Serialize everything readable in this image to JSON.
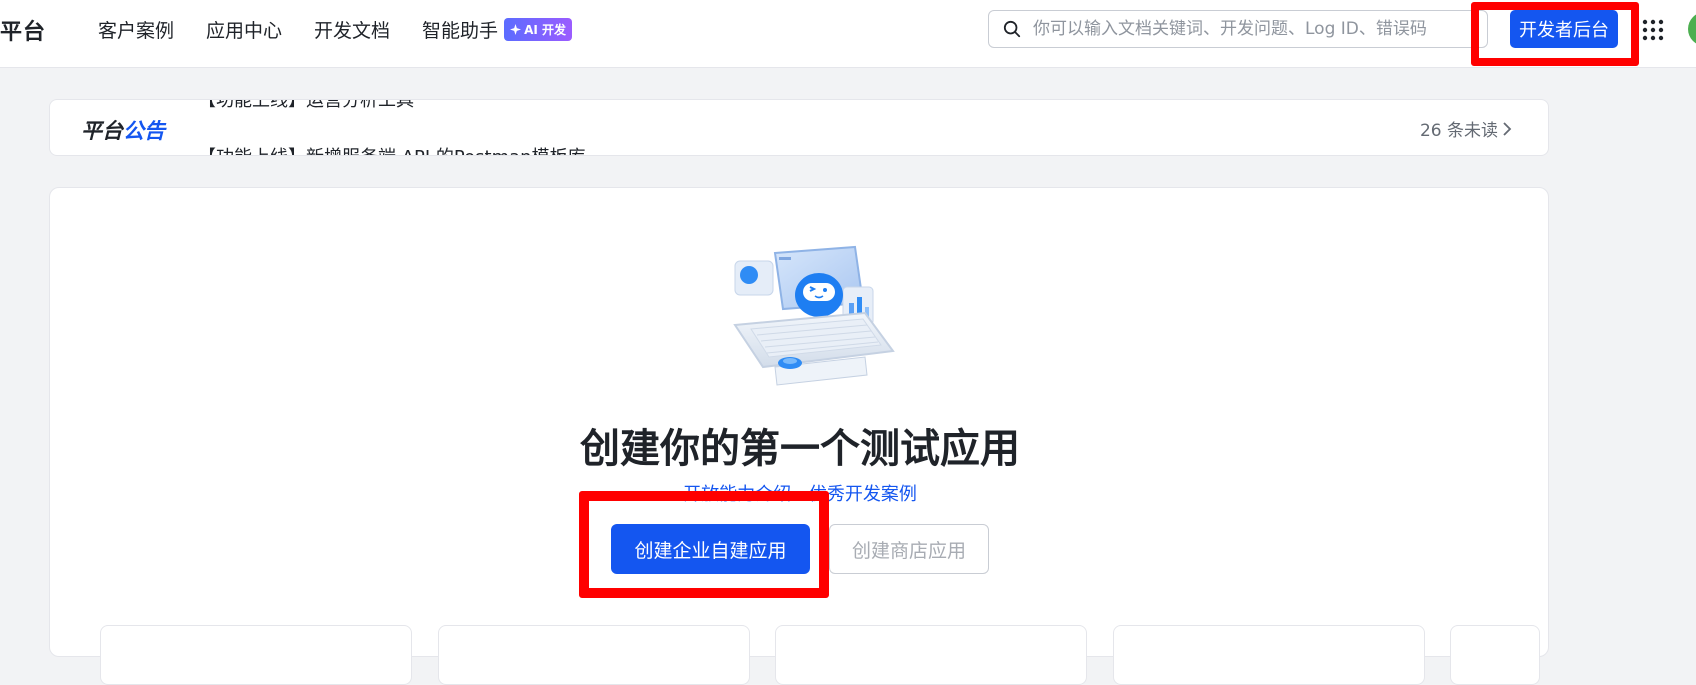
{
  "header": {
    "brand": "平台",
    "nav": [
      {
        "label": "客户案例"
      },
      {
        "label": "应用中心"
      },
      {
        "label": "开发文档"
      },
      {
        "label": "智能助手"
      }
    ],
    "ai_badge": "AI 开发",
    "search_placeholder": "你可以输入文档关键词、开发问题、Log ID、错误码",
    "dev_console_button": "开发者后台"
  },
  "announcement": {
    "title_part1": "平台",
    "title_part2": "公告",
    "items": [
      "【功能上线】运营分析工具",
      "【功能上线】新增服务端 API 的Postman模板库"
    ],
    "unread": "26 条未读"
  },
  "main": {
    "headline": "创建你的第一个测试应用",
    "link1": "开放能力介绍",
    "link2": "优秀开发案例",
    "create_custom_app": "创建企业自建应用",
    "create_store_app": "创建商店应用"
  },
  "colors": {
    "primary": "#1456f0",
    "highlight": "#ff0000",
    "background": "#f2f3f5"
  },
  "icons": {
    "search": "search-icon",
    "apps": "apps-grid-icon",
    "chevron": "chevron-right-icon",
    "sparkle": "sparkle-icon"
  }
}
